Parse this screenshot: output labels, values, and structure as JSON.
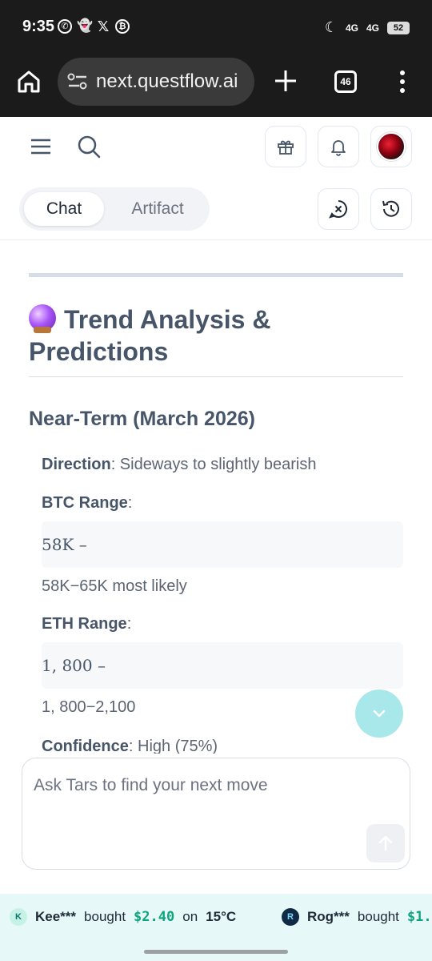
{
  "status_bar": {
    "time": "9:35",
    "network_1": "4G",
    "network_2": "4G",
    "battery": "52"
  },
  "browser": {
    "url": "next.questflow.ai",
    "tab_count": "46"
  },
  "tabs": {
    "chat": "Chat",
    "artifact": "Artifact"
  },
  "content": {
    "section_title": "Trend Analysis & Predictions",
    "subsection_title": "Near-Term (March 2026)",
    "direction_label": "Direction",
    "direction_value": ": Sideways to slightly bearish",
    "btc_label": "BTC Range",
    "btc_colon": ":",
    "btc_math": "58K –",
    "btc_text": "58K−65K most likely",
    "eth_label": "ETH Range",
    "eth_colon": ":",
    "eth_math": "1, 800 –",
    "eth_text": "1, 800−2,100",
    "confidence_label": "Confidence",
    "confidence_value": ": High (75%)"
  },
  "composer": {
    "placeholder": "Ask Tars to find your next move"
  },
  "ticker": [
    {
      "avatar": "K",
      "user": "Kee***",
      "action": "bought",
      "amount": "$2.40",
      "on": "on",
      "market": "15°C"
    },
    {
      "avatar": "R",
      "user": "Rog***",
      "action": "bought",
      "amount": "$1."
    }
  ],
  "colors": {
    "accent_teal": "#a8e8ea",
    "ticker_bg": "#e6f8f7",
    "ticker_amount": "#10a37f"
  },
  "icons": [
    "home-icon",
    "tune-icon",
    "plus-icon",
    "tabs-icon",
    "more-vert-icon",
    "menu-icon",
    "search-icon",
    "gift-icon",
    "bell-icon",
    "avatar",
    "new-chat-icon",
    "history-icon",
    "crystal-ball-icon",
    "chevron-down-icon",
    "arrow-up-icon"
  ]
}
